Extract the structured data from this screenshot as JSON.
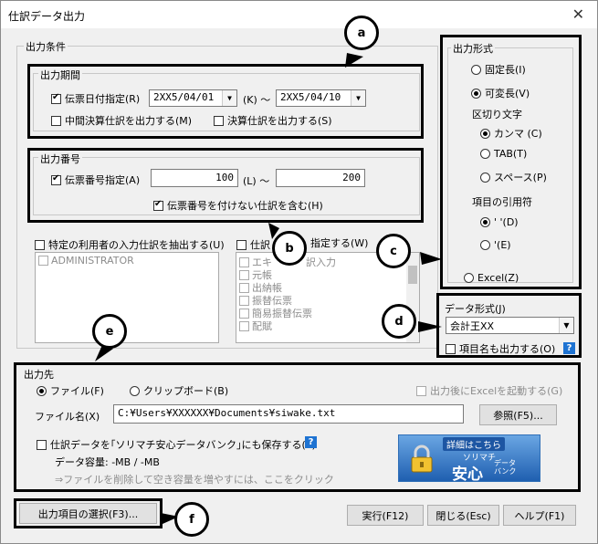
{
  "window": {
    "title": "仕訳データ出力",
    "close": "✕"
  },
  "output_conditions": {
    "group_label": "出力条件",
    "period": {
      "group_label": "出力期間",
      "slip_date_label": "伝票日付指定(R)",
      "slip_date_checked": true,
      "date_from": "2XX5/04/01",
      "date_sep": "(K) ～",
      "date_to": "2XX5/04/10",
      "interim_label": "中間決算仕訳を出力する(M)",
      "interim_checked": false,
      "closing_label": "決算仕訳を出力する(S)",
      "closing_checked": false
    },
    "number": {
      "group_label": "出力番号",
      "slip_no_label": "伝票番号指定(A)",
      "slip_no_checked": true,
      "no_from": "100",
      "no_sep": "(L) ～",
      "no_to": "200",
      "include_unnumbered_label": "伝票番号を付けない仕訳を含む(H)",
      "include_unnumbered_checked": true
    },
    "user_filter": {
      "label": "特定の利用者の入力仕訳を抽出する(U)",
      "checked": false,
      "users": [
        "ADMINISTRATOR"
      ]
    },
    "journal_filter": {
      "label_head": "仕訳",
      "label_tail": "指定する(W)",
      "checked": false,
      "items": [
        "エキ",
        "訳入力",
        "元帳",
        "出納帳",
        "振替伝票",
        "簡易振替伝票",
        "配賦"
      ]
    }
  },
  "output_format": {
    "group_label": "出力形式",
    "fixed_label": "固定長(I)",
    "variable_label": "可変長(V)",
    "selected": "variable",
    "delimiter_label": "区切り文字",
    "comma_label": "カンマ (C)",
    "tab_label": "TAB(T)",
    "space_label": "スペース(P)",
    "delimiter_selected": "comma",
    "quote_label": "項目の引用符",
    "dquote_label": "' '(D)",
    "squote_label": "'(E)",
    "quote_selected": "dquote",
    "excel_label": "Excel(Z)"
  },
  "data_format": {
    "group_label": "データ形式(J)",
    "selected": "会計王XX",
    "item_names_label": "項目名も出力する(O)",
    "item_names_checked": false,
    "help": "?"
  },
  "destination": {
    "group_label": "出力先",
    "file_label": "ファイル(F)",
    "clipboard_label": "クリップボード(B)",
    "selected": "file",
    "launch_excel_label": "出力後にExcelを起動する(G)",
    "filename_label": "ファイル名(X)",
    "filename_value": "C:¥Users¥XXXXXX¥Documents¥siwake.txt",
    "browse_label": "参照(F5)...",
    "bank_save_label": "仕訳データを｢ソリマチ安心データバンク｣にも保存する(Y)",
    "bank_save_checked": false,
    "help": "?",
    "capacity_label": "データ容量: -MB / -MB",
    "hint": "⇒ファイルを削除して空き容量を増やすには、ここをクリック",
    "banner": {
      "top": "詳細はこちら",
      "brand": "ソリマチ",
      "title": "安心",
      "sub1": "データ",
      "sub2": "バンク"
    }
  },
  "buttons": {
    "select_items": "出力項目の選択(F3)...",
    "execute": "実行(F12)",
    "close": "閉じる(Esc)",
    "help": "ヘルプ(F1)"
  },
  "callouts": {
    "a": "a",
    "b": "b",
    "c": "c",
    "d": "d",
    "e": "e",
    "f": "f"
  }
}
